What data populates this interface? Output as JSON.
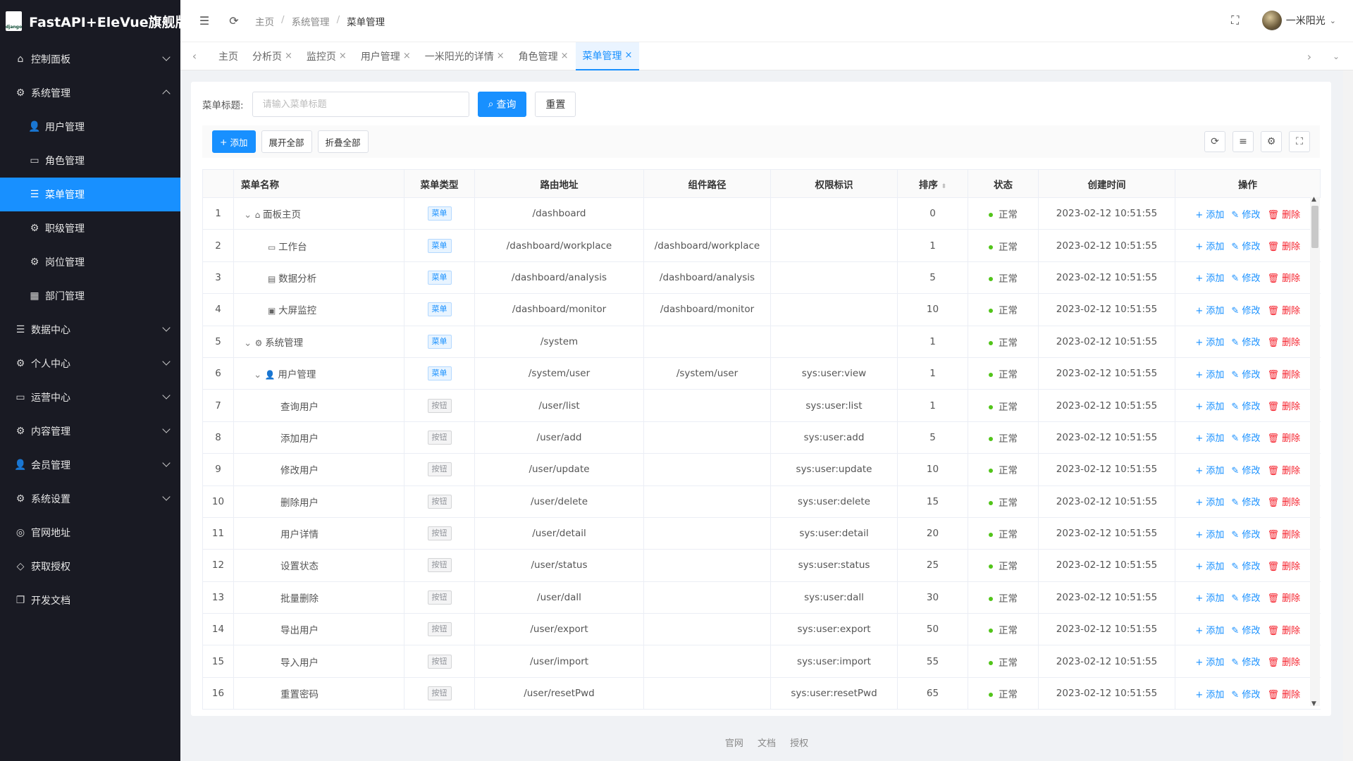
{
  "app": {
    "title": "FastAPI+EleVue旗舰版",
    "logo_text": "django"
  },
  "sidebar": {
    "items": [
      {
        "label": "控制面板",
        "icon": "home-icon",
        "expand": "down"
      },
      {
        "label": "系统管理",
        "icon": "gear-icon",
        "expand": "up"
      },
      {
        "label": "用户管理",
        "icon": "user-icon",
        "sub": true
      },
      {
        "label": "角色管理",
        "icon": "idcard-icon",
        "sub": true
      },
      {
        "label": "菜单管理",
        "icon": "menu-icon",
        "sub": true,
        "active": true
      },
      {
        "label": "职级管理",
        "icon": "gear-icon",
        "sub": true
      },
      {
        "label": "岗位管理",
        "icon": "gear-icon",
        "sub": true
      },
      {
        "label": "部门管理",
        "icon": "building-icon",
        "sub": true
      },
      {
        "label": "数据中心",
        "icon": "database-icon",
        "expand": "down"
      },
      {
        "label": "个人中心",
        "icon": "gears-icon",
        "expand": "down"
      },
      {
        "label": "运营中心",
        "icon": "card-icon",
        "expand": "down"
      },
      {
        "label": "内容管理",
        "icon": "gears-icon",
        "expand": "down"
      },
      {
        "label": "会员管理",
        "icon": "user-icon",
        "expand": "down"
      },
      {
        "label": "系统设置",
        "icon": "gears-icon",
        "expand": "down"
      },
      {
        "label": "官网地址",
        "icon": "globe-icon"
      },
      {
        "label": "获取授权",
        "icon": "diamond-icon"
      },
      {
        "label": "开发文档",
        "icon": "copy-icon"
      }
    ]
  },
  "header": {
    "breadcrumb": [
      "主页",
      "系统管理",
      "菜单管理"
    ],
    "user_name": "一米阳光"
  },
  "tabs": [
    {
      "label": "主页",
      "closable": false
    },
    {
      "label": "分析页",
      "closable": true
    },
    {
      "label": "监控页",
      "closable": true
    },
    {
      "label": "用户管理",
      "closable": true
    },
    {
      "label": "一米阳光的详情",
      "closable": true
    },
    {
      "label": "角色管理",
      "closable": true
    },
    {
      "label": "菜单管理",
      "closable": true,
      "active": true
    }
  ],
  "search": {
    "label": "菜单标题:",
    "placeholder": "请输入菜单标题",
    "query_label": "查询",
    "reset_label": "重置"
  },
  "toolbar": {
    "add_label": "添加",
    "expand_label": "展开全部",
    "collapse_label": "折叠全部"
  },
  "table": {
    "columns": [
      "菜单名称",
      "菜单类型",
      "路由地址",
      "组件路径",
      "权限标识",
      "排序",
      "状态",
      "创建时间",
      "操作"
    ],
    "actions": {
      "add": "添加",
      "edit": "修改",
      "delete": "删除"
    },
    "rows": [
      {
        "no": "1",
        "name": "面板主页",
        "level": 0,
        "expand": true,
        "icon": "home-icon",
        "type": "菜单",
        "route": "/dashboard",
        "component": "",
        "perm": "",
        "sort": "0",
        "status": "正常",
        "created": "2023-02-12 10:51:55"
      },
      {
        "no": "2",
        "name": "工作台",
        "level": 1,
        "icon": "monitor-icon",
        "type": "菜单",
        "route": "/dashboard/workplace",
        "component": "/dashboard/workplace",
        "perm": "",
        "sort": "1",
        "status": "正常",
        "created": "2023-02-12 10:51:55"
      },
      {
        "no": "3",
        "name": "数据分析",
        "level": 1,
        "icon": "analysis-icon",
        "type": "菜单",
        "route": "/dashboard/analysis",
        "component": "/dashboard/analysis",
        "perm": "",
        "sort": "5",
        "status": "正常",
        "created": "2023-02-12 10:51:55"
      },
      {
        "no": "4",
        "name": "大屏监控",
        "level": 1,
        "icon": "screen-icon",
        "type": "菜单",
        "route": "/dashboard/monitor",
        "component": "/dashboard/monitor",
        "perm": "",
        "sort": "10",
        "status": "正常",
        "created": "2023-02-12 10:51:55"
      },
      {
        "no": "5",
        "name": "系统管理",
        "level": 0,
        "expand": true,
        "icon": "gear-icon",
        "type": "菜单",
        "route": "/system",
        "component": "",
        "perm": "",
        "sort": "1",
        "status": "正常",
        "created": "2023-02-12 10:51:55"
      },
      {
        "no": "6",
        "name": "用户管理",
        "level": 1,
        "expand": true,
        "icon": "user-icon",
        "type": "菜单",
        "route": "/system/user",
        "component": "/system/user",
        "perm": "sys:user:view",
        "sort": "1",
        "status": "正常",
        "created": "2023-02-12 10:51:55"
      },
      {
        "no": "7",
        "name": "查询用户",
        "level": 2,
        "type": "按钮",
        "route": "/user/list",
        "component": "",
        "perm": "sys:user:list",
        "sort": "1",
        "status": "正常",
        "created": "2023-02-12 10:51:55"
      },
      {
        "no": "8",
        "name": "添加用户",
        "level": 2,
        "type": "按钮",
        "route": "/user/add",
        "component": "",
        "perm": "sys:user:add",
        "sort": "5",
        "status": "正常",
        "created": "2023-02-12 10:51:55"
      },
      {
        "no": "9",
        "name": "修改用户",
        "level": 2,
        "type": "按钮",
        "route": "/user/update",
        "component": "",
        "perm": "sys:user:update",
        "sort": "10",
        "status": "正常",
        "created": "2023-02-12 10:51:55"
      },
      {
        "no": "10",
        "name": "删除用户",
        "level": 2,
        "type": "按钮",
        "route": "/user/delete",
        "component": "",
        "perm": "sys:user:delete",
        "sort": "15",
        "status": "正常",
        "created": "2023-02-12 10:51:55"
      },
      {
        "no": "11",
        "name": "用户详情",
        "level": 2,
        "type": "按钮",
        "route": "/user/detail",
        "component": "",
        "perm": "sys:user:detail",
        "sort": "20",
        "status": "正常",
        "created": "2023-02-12 10:51:55"
      },
      {
        "no": "12",
        "name": "设置状态",
        "level": 2,
        "type": "按钮",
        "route": "/user/status",
        "component": "",
        "perm": "sys:user:status",
        "sort": "25",
        "status": "正常",
        "created": "2023-02-12 10:51:55"
      },
      {
        "no": "13",
        "name": "批量删除",
        "level": 2,
        "type": "按钮",
        "route": "/user/dall",
        "component": "",
        "perm": "sys:user:dall",
        "sort": "30",
        "status": "正常",
        "created": "2023-02-12 10:51:55"
      },
      {
        "no": "14",
        "name": "导出用户",
        "level": 2,
        "type": "按钮",
        "route": "/user/export",
        "component": "",
        "perm": "sys:user:export",
        "sort": "50",
        "status": "正常",
        "created": "2023-02-12 10:51:55"
      },
      {
        "no": "15",
        "name": "导入用户",
        "level": 2,
        "type": "按钮",
        "route": "/user/import",
        "component": "",
        "perm": "sys:user:import",
        "sort": "55",
        "status": "正常",
        "created": "2023-02-12 10:51:55"
      },
      {
        "no": "16",
        "name": "重置密码",
        "level": 2,
        "type": "按钮",
        "route": "/user/resetPwd",
        "component": "",
        "perm": "sys:user:resetPwd",
        "sort": "65",
        "status": "正常",
        "created": "2023-02-12 10:51:55"
      }
    ]
  },
  "footer": {
    "links": [
      "官网",
      "文档",
      "授权"
    ]
  },
  "colors": {
    "primary": "#1890ff",
    "danger": "#f5222d",
    "success": "#52c41a",
    "sidebar": "#191a23"
  }
}
